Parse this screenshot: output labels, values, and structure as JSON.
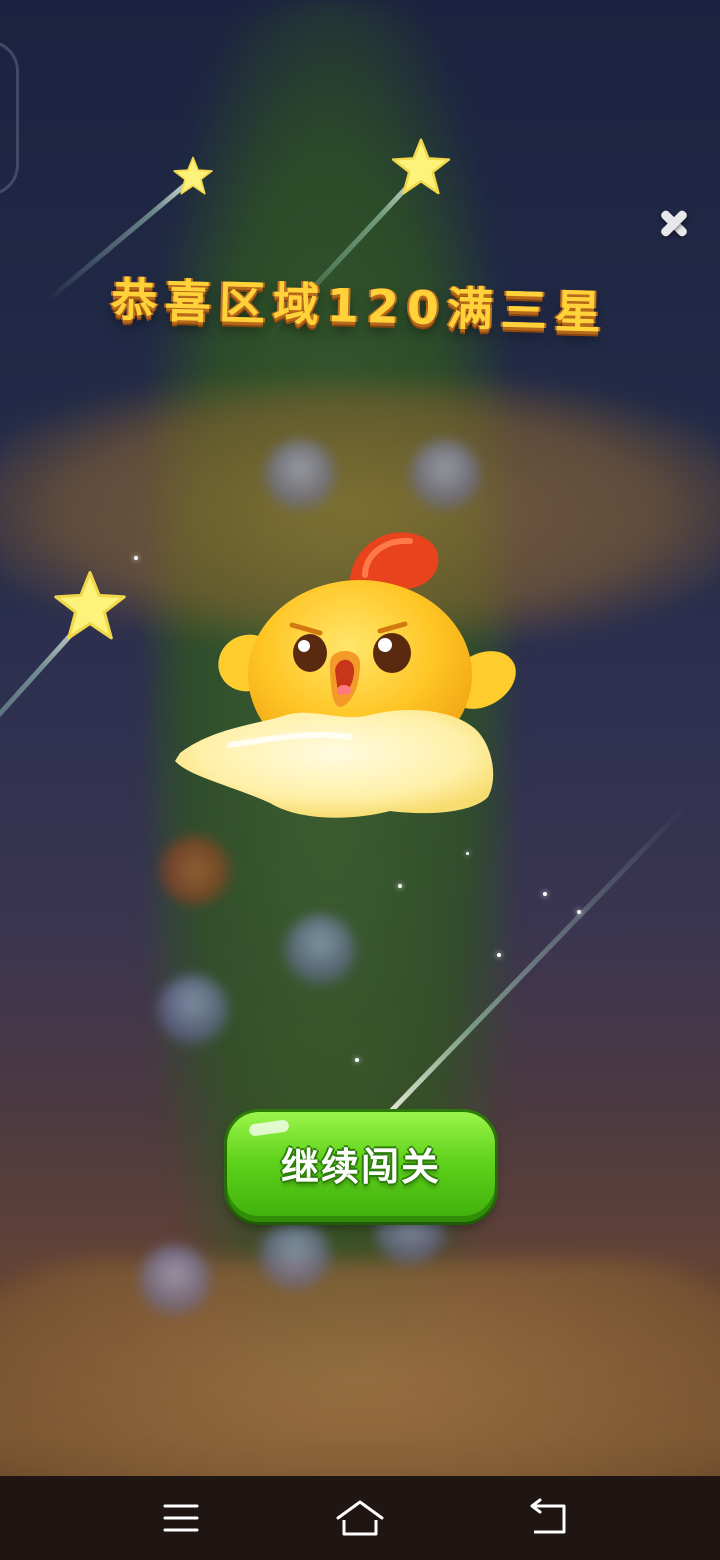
{
  "dialog": {
    "title": "恭喜区域120满三星",
    "continue_label": "继续闯关"
  },
  "icons": {
    "close": "close-icon",
    "mascot": "chick-mascot",
    "nav_menu": "menu-icon",
    "nav_home": "home-icon",
    "nav_back": "back-icon"
  },
  "colors": {
    "title": "#ffd23a",
    "button": "#5fd21b",
    "background_top": "#1c2340",
    "navbar": "#1f1613"
  }
}
